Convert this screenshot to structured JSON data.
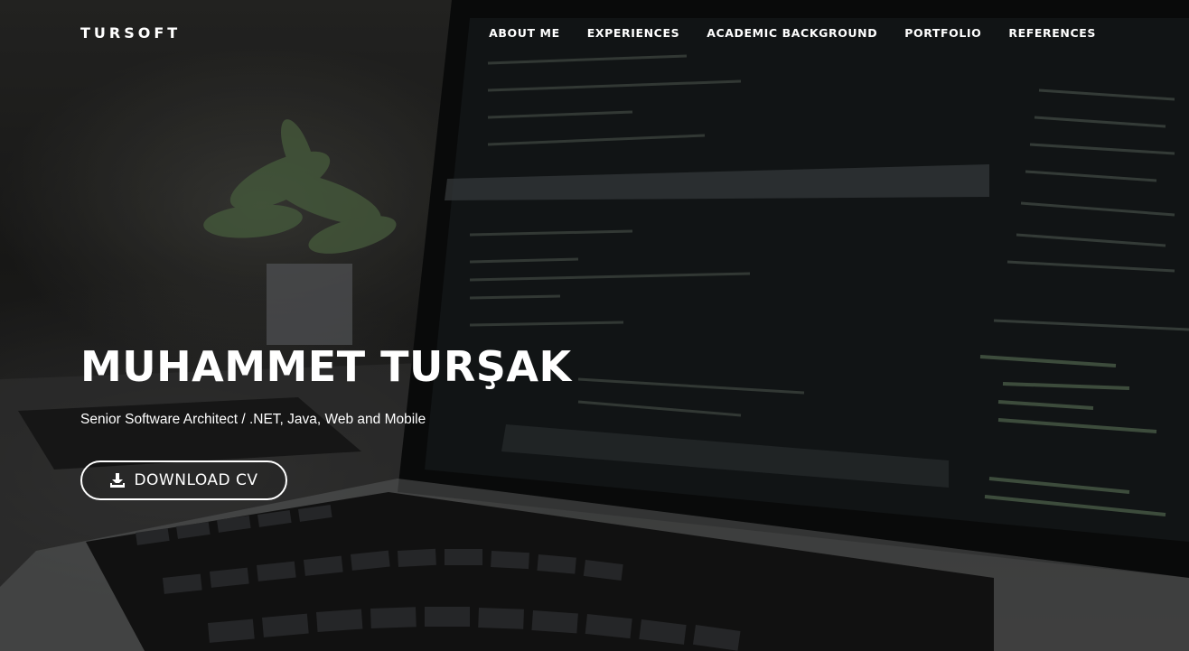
{
  "brand": "TURSOFT",
  "nav": {
    "items": [
      {
        "label": "ABOUT ME"
      },
      {
        "label": "EXPERIENCES"
      },
      {
        "label": "ACADEMIC BACKGROUND"
      },
      {
        "label": "PORTFOLIO"
      },
      {
        "label": "REFERENCES"
      }
    ]
  },
  "hero": {
    "name": "MUHAMMET TURŞAK",
    "subtitle": "Senior Software Architect / .NET, Java, Web and Mobile",
    "cv_button": {
      "label": "DOWNLOAD CV",
      "icon": "download-icon"
    },
    "background": "laptop-with-code-editor-photo"
  },
  "colors": {
    "text": "#ffffff",
    "background": "#1b1b1b"
  }
}
